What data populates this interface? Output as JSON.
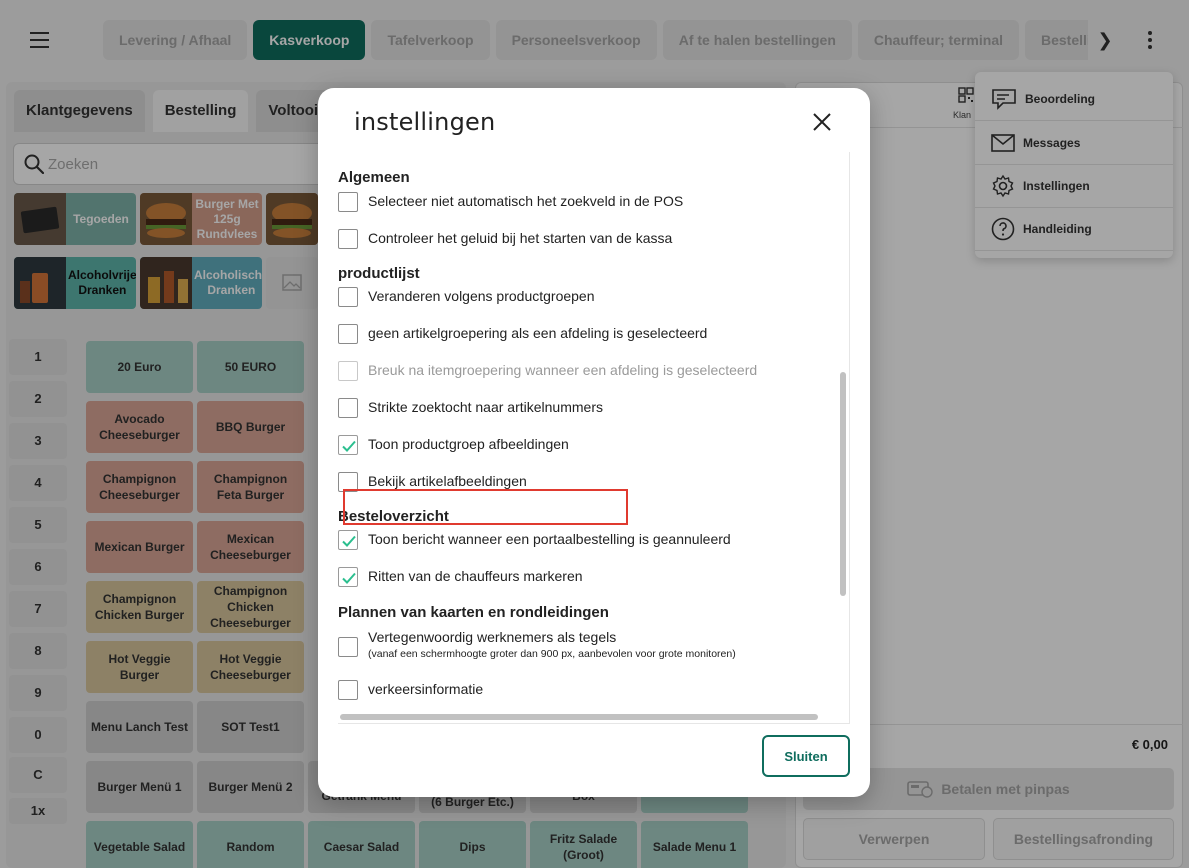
{
  "topbar": {
    "tabs": [
      {
        "label": "Levering / Afhaal",
        "active": false
      },
      {
        "label": "Kasverkoop",
        "active": true
      },
      {
        "label": "Tafelverkoop",
        "active": false
      },
      {
        "label": "Personeelsverkoop",
        "active": false
      },
      {
        "label": "Af te halen bestellingen",
        "active": false
      },
      {
        "label": "Chauffeur; terminal",
        "active": false
      },
      {
        "label": "Bestelling overz",
        "active": false
      }
    ],
    "next_label": "❯"
  },
  "left": {
    "subtabs": [
      "Klantgegevens",
      "Bestelling",
      "Voltooii"
    ],
    "search_placeholder": "Zoeken",
    "groups": [
      "Tegoeden",
      "Burger Met 125g Rundvlees",
      "Alcoholvrije Dranken",
      "Alcoholische Dranken"
    ],
    "numpad": [
      "1",
      "2",
      "3",
      "4",
      "5",
      "6",
      "7",
      "8",
      "9",
      "0",
      "C",
      "1x"
    ],
    "products": [
      {
        "label": "20 Euro",
        "color": "teal"
      },
      {
        "label": "50 EURO",
        "color": "teal"
      },
      {
        "label": "Avocado Cheeseburger",
        "color": "red"
      },
      {
        "label": "BBQ Burger",
        "color": "red"
      },
      {
        "label": "Champignon Cheeseburger",
        "color": "red"
      },
      {
        "label": "Champignon Feta Burger",
        "color": "red"
      },
      {
        "label": "Mexican Burger",
        "color": "red"
      },
      {
        "label": "Mexican Cheeseburger",
        "color": "red"
      },
      {
        "label": "Champignon Chicken Burger",
        "color": "yellow"
      },
      {
        "label": "Champignon Chicken Cheeseburger",
        "color": "yellow"
      },
      {
        "label": "Hot Veggie Burger",
        "color": "yellow"
      },
      {
        "label": "Hot Veggie Cheeseburger",
        "color": "yellow"
      },
      {
        "label": "Menu Lanch Test",
        "color": "grey"
      },
      {
        "label": "SOT Test1",
        "color": "grey"
      },
      {
        "label": "Burger Menü 1",
        "color": "grey"
      },
      {
        "label": "Burger Menü 2",
        "color": "grey"
      },
      {
        "label": "Vegetable Salad",
        "color": "teal"
      },
      {
        "label": "Random",
        "color": "teal"
      },
      {
        "label": "Caesar Salad",
        "color": "teal"
      },
      {
        "label": "Dips",
        "color": "teal"
      },
      {
        "label": "Fritz Salade (Groot)",
        "color": "teal"
      },
      {
        "label": "Salade Menu 1",
        "color": "teal"
      }
    ],
    "partial_products": [
      "Getrank Menu",
      "(6 Burger Etc.)",
      "Box"
    ]
  },
  "right": {
    "qr_label": "Klan",
    "total": "€ 0,00",
    "pay_label": "Betalen met pinpas",
    "discard_label": "Verwerpen",
    "finish_label": "Bestellingsafronding"
  },
  "dropdown": {
    "items": [
      {
        "label": "Beoordeling",
        "icon": "review-icon"
      },
      {
        "label": "Messages",
        "icon": "mail-icon"
      },
      {
        "label": "Instellingen",
        "icon": "gear-icon"
      },
      {
        "label": "Handleiding",
        "icon": "help-icon"
      }
    ]
  },
  "modal": {
    "title": "instellingen",
    "close_label": "Sluiten",
    "sections": [
      {
        "title": "Algemeen",
        "options": [
          {
            "label": "Selecteer niet automatisch het zoekveld in de POS",
            "checked": false
          },
          {
            "label": "Controleer het geluid bij het starten van de kassa",
            "checked": false
          }
        ]
      },
      {
        "title": "productlijst",
        "options": [
          {
            "label": "Veranderen volgens productgroepen",
            "checked": false
          },
          {
            "label": "geen artikelgroepering als een afdeling is geselecteerd",
            "checked": false
          },
          {
            "label": "Breuk na itemgroepering wanneer een afdeling is geselecteerd",
            "checked": false,
            "disabled": true
          },
          {
            "label": "Strikte zoektocht naar artikelnummers",
            "checked": false
          },
          {
            "label": "Toon productgroep afbeeldingen",
            "checked": true,
            "highlighted": true
          },
          {
            "label": "Bekijk artikelafbeeldingen",
            "checked": false
          }
        ]
      },
      {
        "title": "Besteloverzicht",
        "options": [
          {
            "label": "Toon bericht wanneer een portaalbestelling is geannuleerd",
            "checked": true
          },
          {
            "label": "Ritten van de chauffeurs markeren",
            "checked": true
          }
        ]
      },
      {
        "title": "Plannen van kaarten en rondleidingen",
        "options": [
          {
            "label": "Vertegenwoordig werknemers als tegels",
            "sublabel": "(vanaf een schermhoogte groter dan 900 px, aanbevolen voor grote monitoren)",
            "checked": false
          },
          {
            "label": "verkeersinformatie",
            "checked": false
          }
        ]
      }
    ]
  },
  "colors": {
    "brand": "#0f6d5e",
    "check": "#2bbf8f",
    "highlight": "#e03a2f"
  }
}
